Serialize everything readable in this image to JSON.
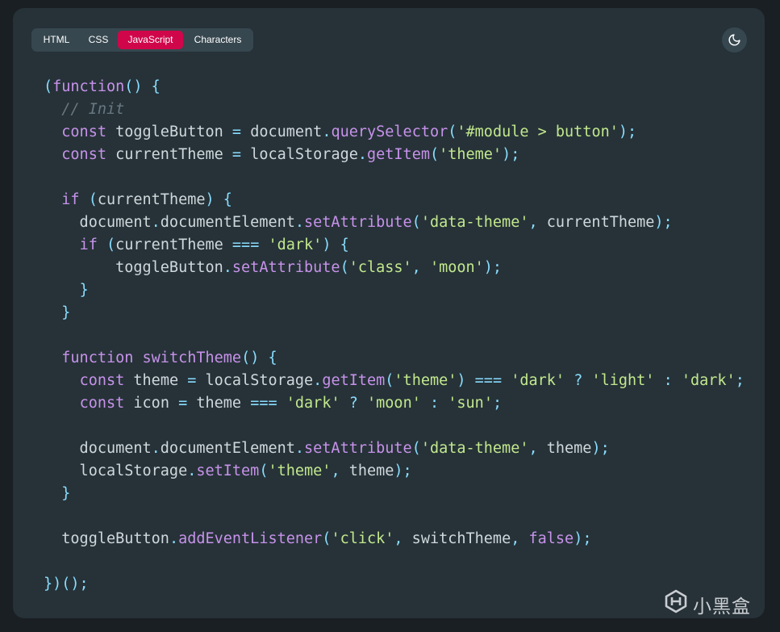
{
  "tabs": [
    {
      "label": "HTML",
      "active": false
    },
    {
      "label": "CSS",
      "active": false
    },
    {
      "label": "JavaScript",
      "active": true
    },
    {
      "label": "Characters",
      "active": false
    }
  ],
  "theme_toggle": {
    "icon": "moon-icon"
  },
  "colors": {
    "background": "#263238",
    "tab_bar": "#37474f",
    "tab_active": "#d0064a",
    "punct": "#89ddff",
    "keyword": "#c792ea",
    "string": "#c3e88d",
    "comment": "#697880",
    "text": "#cfd8dc"
  },
  "code_lines": [
    [
      [
        "punct",
        "("
      ],
      [
        "keyword",
        "function"
      ],
      [
        "punct",
        "()"
      ],
      [
        "text",
        " "
      ],
      [
        "punct",
        "{"
      ]
    ],
    [
      [
        "text",
        "  "
      ],
      [
        "comment",
        "// Init"
      ]
    ],
    [
      [
        "text",
        "  "
      ],
      [
        "keyword",
        "const"
      ],
      [
        "text",
        " toggleButton "
      ],
      [
        "punct",
        "="
      ],
      [
        "text",
        " document"
      ],
      [
        "punct",
        "."
      ],
      [
        "keyword",
        "querySelector"
      ],
      [
        "punct",
        "("
      ],
      [
        "string",
        "'#module > button'"
      ],
      [
        "punct",
        ");"
      ]
    ],
    [
      [
        "text",
        "  "
      ],
      [
        "keyword",
        "const"
      ],
      [
        "text",
        " currentTheme "
      ],
      [
        "punct",
        "="
      ],
      [
        "text",
        " localStorage"
      ],
      [
        "punct",
        "."
      ],
      [
        "keyword",
        "getItem"
      ],
      [
        "punct",
        "("
      ],
      [
        "string",
        "'theme'"
      ],
      [
        "punct",
        ");"
      ]
    ],
    [],
    [
      [
        "text",
        "  "
      ],
      [
        "keyword",
        "if"
      ],
      [
        "text",
        " "
      ],
      [
        "punct",
        "("
      ],
      [
        "text",
        "currentTheme"
      ],
      [
        "punct",
        ")"
      ],
      [
        "text",
        " "
      ],
      [
        "punct",
        "{"
      ]
    ],
    [
      [
        "text",
        "    document"
      ],
      [
        "punct",
        "."
      ],
      [
        "text",
        "documentElement"
      ],
      [
        "punct",
        "."
      ],
      [
        "keyword",
        "setAttribute"
      ],
      [
        "punct",
        "("
      ],
      [
        "string",
        "'data-theme'"
      ],
      [
        "punct",
        ","
      ],
      [
        "text",
        " currentTheme"
      ],
      [
        "punct",
        ");"
      ]
    ],
    [
      [
        "text",
        "    "
      ],
      [
        "keyword",
        "if"
      ],
      [
        "text",
        " "
      ],
      [
        "punct",
        "("
      ],
      [
        "text",
        "currentTheme "
      ],
      [
        "punct",
        "==="
      ],
      [
        "text",
        " "
      ],
      [
        "string",
        "'dark'"
      ],
      [
        "punct",
        ")"
      ],
      [
        "text",
        " "
      ],
      [
        "punct",
        "{"
      ]
    ],
    [
      [
        "text",
        "        toggleButton"
      ],
      [
        "punct",
        "."
      ],
      [
        "keyword",
        "setAttribute"
      ],
      [
        "punct",
        "("
      ],
      [
        "string",
        "'class'"
      ],
      [
        "punct",
        ","
      ],
      [
        "text",
        " "
      ],
      [
        "string",
        "'moon'"
      ],
      [
        "punct",
        ");"
      ]
    ],
    [
      [
        "text",
        "    "
      ],
      [
        "punct",
        "}"
      ]
    ],
    [
      [
        "text",
        "  "
      ],
      [
        "punct",
        "}"
      ]
    ],
    [],
    [
      [
        "text",
        "  "
      ],
      [
        "keyword",
        "function"
      ],
      [
        "text",
        " "
      ],
      [
        "keyword",
        "switchTheme"
      ],
      [
        "punct",
        "()"
      ],
      [
        "text",
        " "
      ],
      [
        "punct",
        "{"
      ]
    ],
    [
      [
        "text",
        "    "
      ],
      [
        "keyword",
        "const"
      ],
      [
        "text",
        " theme "
      ],
      [
        "punct",
        "="
      ],
      [
        "text",
        " localStorage"
      ],
      [
        "punct",
        "."
      ],
      [
        "keyword",
        "getItem"
      ],
      [
        "punct",
        "("
      ],
      [
        "string",
        "'theme'"
      ],
      [
        "punct",
        ")"
      ],
      [
        "text",
        " "
      ],
      [
        "punct",
        "==="
      ],
      [
        "text",
        " "
      ],
      [
        "string",
        "'dark'"
      ],
      [
        "text",
        " "
      ],
      [
        "punct",
        "?"
      ],
      [
        "text",
        " "
      ],
      [
        "string",
        "'light'"
      ],
      [
        "text",
        " "
      ],
      [
        "punct",
        ":"
      ],
      [
        "text",
        " "
      ],
      [
        "string",
        "'dark'"
      ],
      [
        "punct",
        ";"
      ]
    ],
    [
      [
        "text",
        "    "
      ],
      [
        "keyword",
        "const"
      ],
      [
        "text",
        " icon "
      ],
      [
        "punct",
        "="
      ],
      [
        "text",
        " theme "
      ],
      [
        "punct",
        "==="
      ],
      [
        "text",
        " "
      ],
      [
        "string",
        "'dark'"
      ],
      [
        "text",
        " "
      ],
      [
        "punct",
        "?"
      ],
      [
        "text",
        " "
      ],
      [
        "string",
        "'moon'"
      ],
      [
        "text",
        " "
      ],
      [
        "punct",
        ":"
      ],
      [
        "text",
        " "
      ],
      [
        "string",
        "'sun'"
      ],
      [
        "punct",
        ";"
      ]
    ],
    [],
    [
      [
        "text",
        "    document"
      ],
      [
        "punct",
        "."
      ],
      [
        "text",
        "documentElement"
      ],
      [
        "punct",
        "."
      ],
      [
        "keyword",
        "setAttribute"
      ],
      [
        "punct",
        "("
      ],
      [
        "string",
        "'data-theme'"
      ],
      [
        "punct",
        ","
      ],
      [
        "text",
        " theme"
      ],
      [
        "punct",
        ");"
      ]
    ],
    [
      [
        "text",
        "    localStorage"
      ],
      [
        "punct",
        "."
      ],
      [
        "keyword",
        "setItem"
      ],
      [
        "punct",
        "("
      ],
      [
        "string",
        "'theme'"
      ],
      [
        "punct",
        ","
      ],
      [
        "text",
        " theme"
      ],
      [
        "punct",
        ");"
      ]
    ],
    [
      [
        "text",
        "  "
      ],
      [
        "punct",
        "}"
      ]
    ],
    [],
    [
      [
        "text",
        "  toggleButton"
      ],
      [
        "punct",
        "."
      ],
      [
        "keyword",
        "addEventListener"
      ],
      [
        "punct",
        "("
      ],
      [
        "string",
        "'click'"
      ],
      [
        "punct",
        ","
      ],
      [
        "text",
        " switchTheme"
      ],
      [
        "punct",
        ","
      ],
      [
        "text",
        " "
      ],
      [
        "keyword",
        "false"
      ],
      [
        "punct",
        ");"
      ]
    ],
    [],
    [
      [
        "punct",
        "})();"
      ]
    ]
  ],
  "watermark": {
    "text": "小黑盒",
    "icon": "heybox-logo-icon"
  }
}
